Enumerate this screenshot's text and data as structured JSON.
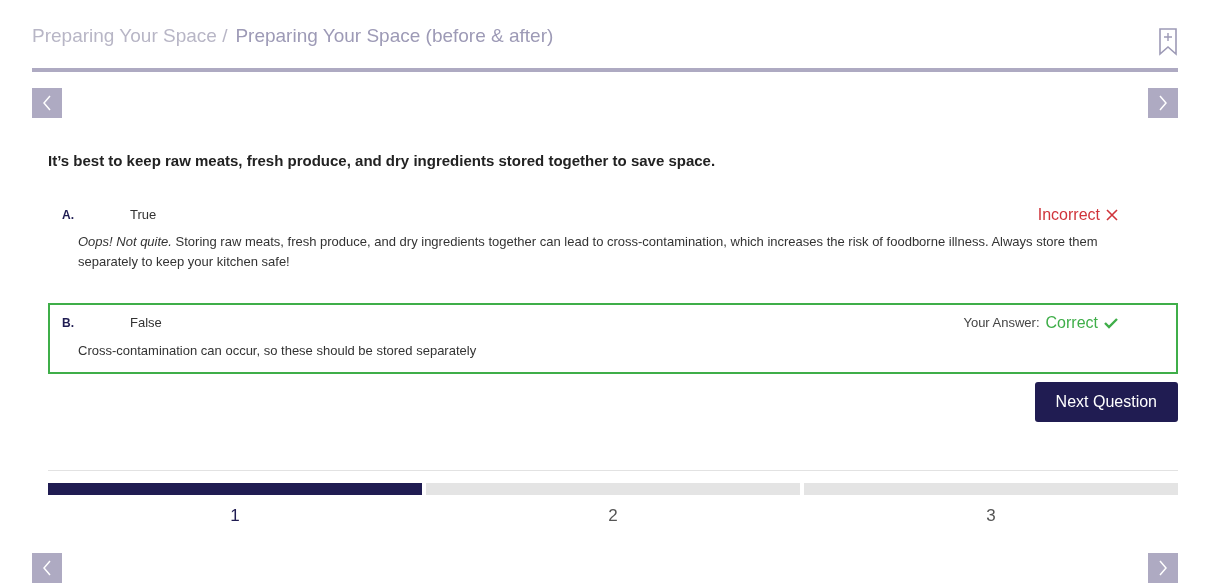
{
  "breadcrumb": {
    "parent": "Preparing Your Space /",
    "current": "Preparing Your Space (before & after)"
  },
  "question": "It’s best to keep raw meats, fresh produce, and dry ingredients stored together to save space.",
  "options": [
    {
      "letter": "A.",
      "text": "True",
      "selected": false,
      "kind": "incorrect",
      "result_label": "Incorrect",
      "feedback": "*Oops! Not quite.* Storing raw meats, fresh produce, and dry ingredients together can lead to cross-contamination, which increases the risk of foodborne illness. Always store them separately to keep your kitchen safe!"
    },
    {
      "letter": "B.",
      "text": "False",
      "selected": true,
      "answer_label": "Your Answer:",
      "kind": "correct",
      "result_label": "Correct",
      "feedback": "Cross-contamination can occur, so these should be stored separately"
    }
  ],
  "next_button": "Next Question",
  "steps": [
    {
      "label": "1",
      "selected": true
    },
    {
      "label": "2",
      "selected": false
    },
    {
      "label": "3",
      "selected": false
    }
  ]
}
